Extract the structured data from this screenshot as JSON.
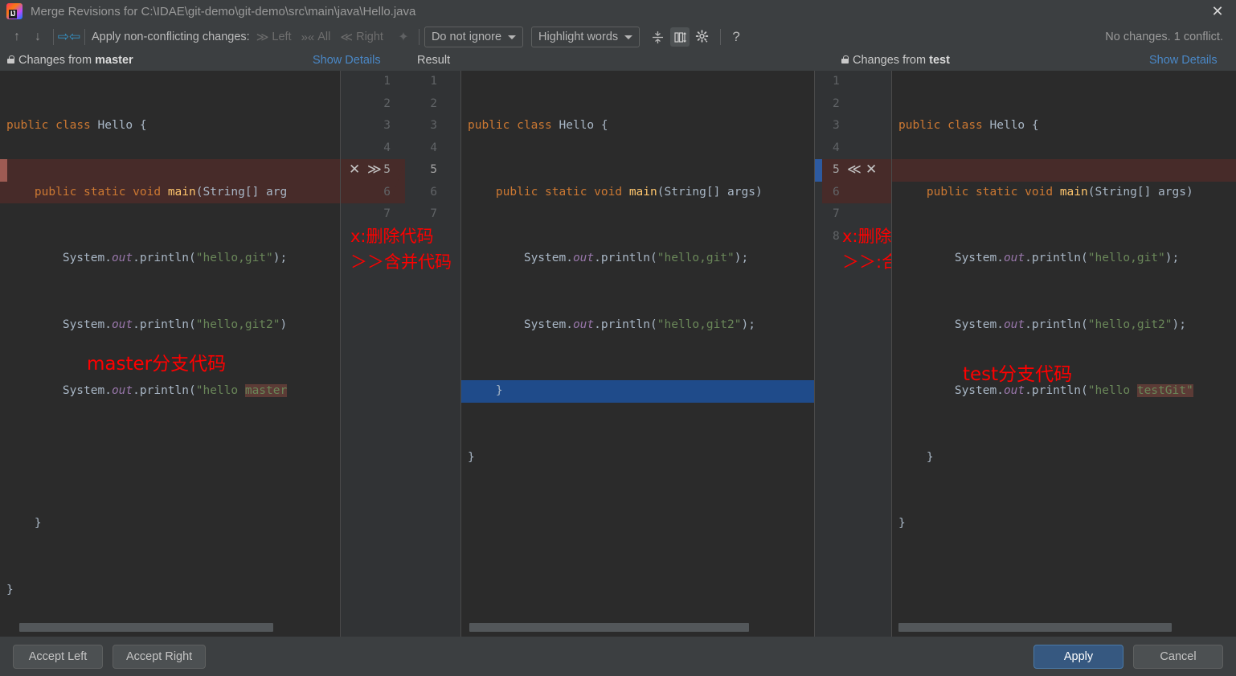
{
  "window": {
    "title": "Merge Revisions for C:\\IDAE\\git-demo\\git-demo\\src\\main\\java\\Hello.java",
    "close_label": "✕",
    "logo_name": "intellij-idea-logo"
  },
  "toolbar": {
    "prev_diff_icon": "↑",
    "next_diff_icon": "↓",
    "collapse_icon": "➔",
    "apply_label": "Apply non-conflicting changes:",
    "apply_left": "Left",
    "apply_all": "All",
    "apply_right": "Right",
    "magic_icon": "✨",
    "ignore_policy": "Do not ignore",
    "highlight_policy": "Highlight words",
    "collapse_unchanged_icon": "≡",
    "sync_scroll_icon": "↕",
    "settings_icon": "⚙",
    "help_icon": "?",
    "status": "No changes. 1 conflict."
  },
  "panes": {
    "left": {
      "header_prefix": "Changes from ",
      "header_branch": "master",
      "show_details": "Show Details"
    },
    "result": {
      "header": "Result"
    },
    "right": {
      "header_prefix": "Changes from ",
      "header_branch": "test",
      "show_details": "Show Details"
    }
  },
  "code": {
    "left_lines": [
      "public class Hello {",
      "    public static void main(String[] arg",
      "        System.out.println(\"hello,git\");",
      "        System.out.println(\"hello,git2\")",
      "        System.out.println(\"hello master",
      "",
      "    }",
      "}"
    ],
    "result_lines": [
      "public class Hello {",
      "    public static void main(String[] args)",
      "        System.out.println(\"hello,git\");",
      "        System.out.println(\"hello,git2\");",
      "    }",
      "}"
    ],
    "right_lines": [
      "public class Hello {",
      "    public static void main(String[] args)",
      "        System.out.println(\"hello,git\");",
      "        System.out.println(\"hello,git2\");",
      "        System.out.println(\"hello testGit\"",
      "    }",
      "}"
    ]
  },
  "gutters": {
    "left_numbers": [
      "1",
      "2",
      "3",
      "4",
      "5",
      "6",
      "7"
    ],
    "result_numbers": [
      "1",
      "2",
      "3",
      "4",
      "5",
      "6",
      "7"
    ],
    "right_numbers": [
      "1",
      "2",
      "3",
      "4",
      "5",
      "6",
      "7",
      "8"
    ],
    "left_conflict_line": "5",
    "right_conflict_line": "5",
    "left_remove_icon": "✕",
    "left_accept_icon": "≫",
    "right_accept_icon": "≪",
    "right_remove_icon": "✕"
  },
  "annotations": {
    "left_legend_1": "x:删除代码",
    "left_legend_2": "＞＞含并代码",
    "right_legend_1": "x:删除代码",
    "right_legend_2": "＞＞:合并代码",
    "left_branch_note": "master分支代码",
    "right_branch_note": "test分支代码"
  },
  "footer": {
    "accept_left": "Accept Left",
    "accept_right": "Accept Right",
    "apply": "Apply",
    "cancel": "Cancel"
  },
  "colors": {
    "conflict_bg": "#472b29",
    "selection_bg": "#1f4b8a",
    "accent_link": "#4a88c7",
    "annotation_red": "#ff0000",
    "primary_button": "#365880"
  }
}
